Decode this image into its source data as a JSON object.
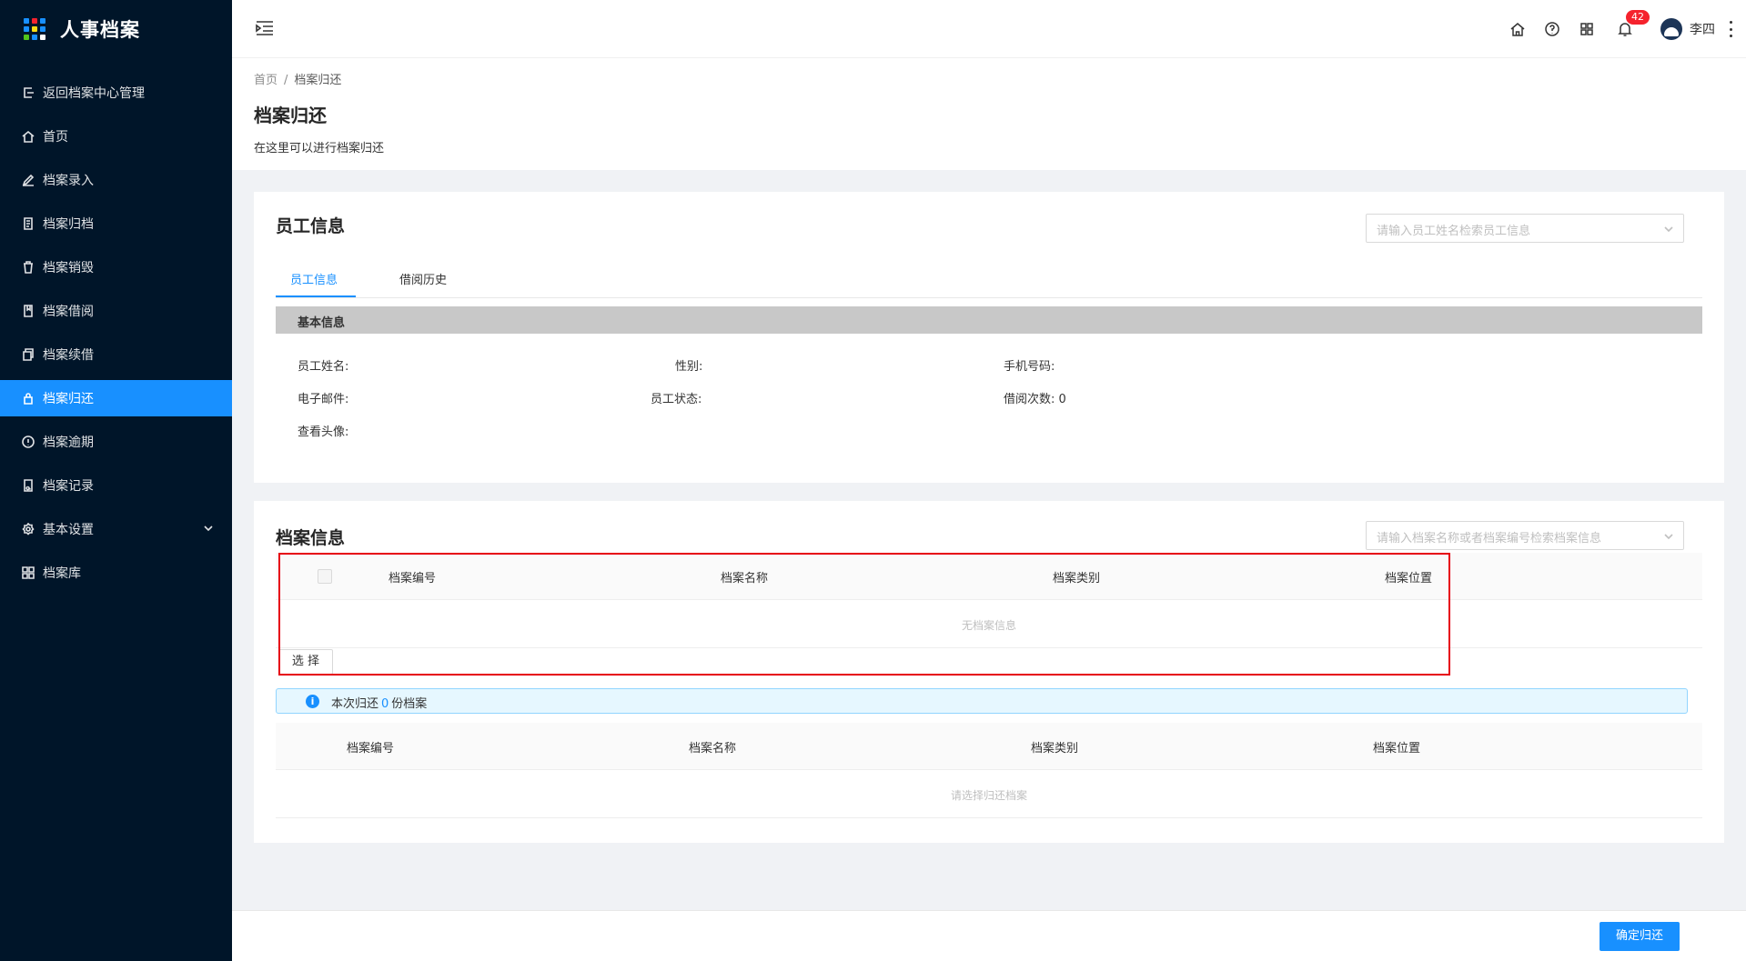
{
  "app": {
    "title": "人事档案"
  },
  "sidebar": {
    "items": [
      {
        "label": "返回档案中心管理",
        "icon": "exit-icon"
      },
      {
        "label": "首页",
        "icon": "home-icon"
      },
      {
        "label": "档案录入",
        "icon": "edit-icon"
      },
      {
        "label": "档案归档",
        "icon": "file-text-icon"
      },
      {
        "label": "档案销毁",
        "icon": "trash-icon"
      },
      {
        "label": "档案借阅",
        "icon": "book-icon"
      },
      {
        "label": "档案续借",
        "icon": "copy-icon"
      },
      {
        "label": "档案归还",
        "icon": "lock-icon",
        "active": true
      },
      {
        "label": "档案逾期",
        "icon": "alert-circle-icon"
      },
      {
        "label": "档案记录",
        "icon": "file-search-icon"
      },
      {
        "label": "基本设置",
        "icon": "settings-icon",
        "has_children": true
      },
      {
        "label": "档案库",
        "icon": "appstore-icon"
      }
    ]
  },
  "header": {
    "notification_count": "42",
    "user_name": "李四"
  },
  "breadcrumb": {
    "home": "首页",
    "separator": "/",
    "current": "档案归还"
  },
  "page": {
    "title": "档案归还",
    "description": "在这里可以进行档案归还"
  },
  "employee_card": {
    "title": "员工信息",
    "search_placeholder": "请输入员工姓名检索员工信息",
    "tabs": [
      "员工信息",
      "借阅历史"
    ],
    "section_title": "基本信息",
    "fields": {
      "name": "员工姓名:",
      "gender": "性别:",
      "phone": "手机号码:",
      "email": "电子邮件:",
      "status": "员工状态:",
      "borrow_count_label": "借阅次数:",
      "borrow_count_value": "0",
      "avatar": "查看头像:"
    }
  },
  "archive_card": {
    "title": "档案信息",
    "search_placeholder": "请输入档案名称或者档案编号检索档案信息",
    "table_columns": [
      "档案编号",
      "档案名称",
      "档案类别",
      "档案位置"
    ],
    "table_empty": "无档案信息",
    "select_button": "选 择",
    "alert_prefix": "本次归还",
    "alert_count": "0",
    "alert_suffix": "份档案",
    "return_columns": [
      "档案编号",
      "档案名称",
      "档案类别",
      "档案位置"
    ],
    "return_empty": "请选择归还档案"
  },
  "footer": {
    "confirm_button": "确定归还"
  },
  "colors": {
    "primary": "#1890ff",
    "sidebar_bg": "#001529",
    "highlight_border": "#e60012",
    "badge": "#f5222d"
  }
}
